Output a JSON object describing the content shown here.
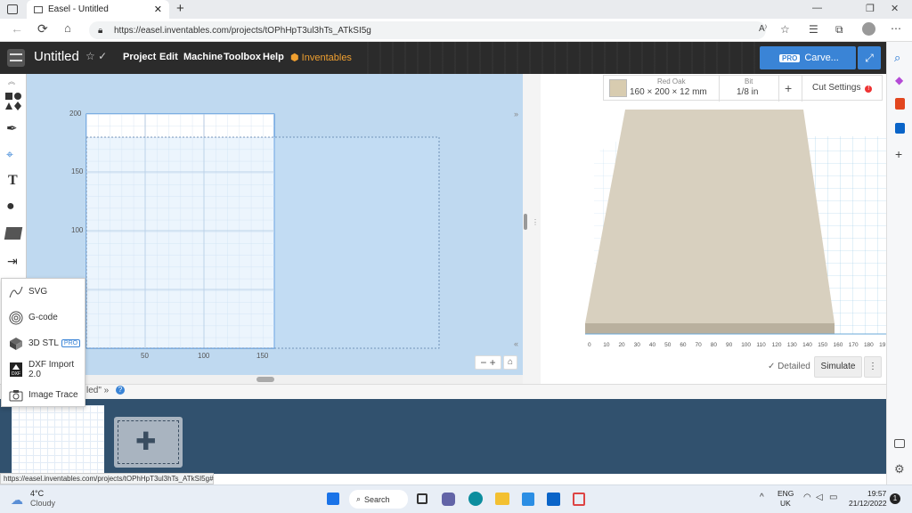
{
  "browser": {
    "tab_title": "Easel - Untitled",
    "url": "https://easel.inventables.com/projects/tOPhHpT3ul3hTs_ATkSI5g",
    "reader_label": "A⁾"
  },
  "header": {
    "project_title": "Untitled",
    "menus": [
      "Project",
      "Edit",
      "Machine",
      "Toolbox",
      "Help"
    ],
    "inventables_label": "Inventables",
    "pro_badge": "PRO",
    "carve_label": "Carve..."
  },
  "canvas": {
    "y_ticks": [
      "200",
      "150",
      "100"
    ],
    "x_ticks": [
      "50",
      "100",
      "150"
    ]
  },
  "import_menu": {
    "items": [
      "SVG",
      "G-code",
      "3D STL",
      "DXF Import 2.0",
      "Image Trace"
    ],
    "pro_badge": "PRO"
  },
  "project_bar": {
    "name_fragment": "led\" »"
  },
  "material": {
    "name": "Red Oak",
    "dims": "160 × 200 × 12 mm",
    "bit_label": "Bit",
    "bit_value": "1/8 in",
    "plus": "+",
    "cut_settings": "Cut Settings"
  },
  "preview": {
    "x_ticks": [
      "0",
      "10",
      "20",
      "30",
      "40",
      "50",
      "60",
      "70",
      "80",
      "90",
      "100",
      "110",
      "120",
      "130",
      "140",
      "150",
      "160",
      "170",
      "180",
      "19"
    ],
    "detailed_label": "Detailed",
    "simulate_label": "Simulate"
  },
  "status_url": "https://easel.inventables.com/projects/tOPhHpT3ul3hTs_ATkSI5g#",
  "taskbar": {
    "temp": "4°C",
    "weather": "Cloudy",
    "search": "Search",
    "lang1": "ENG",
    "lang2": "UK",
    "time": "19:57",
    "date": "21/12/2022",
    "notif": "1"
  },
  "colors": {
    "accent": "#3a84d6",
    "header": "#2b2b2b",
    "canvas": "#bfd9f0",
    "bottom": "#31516e"
  }
}
